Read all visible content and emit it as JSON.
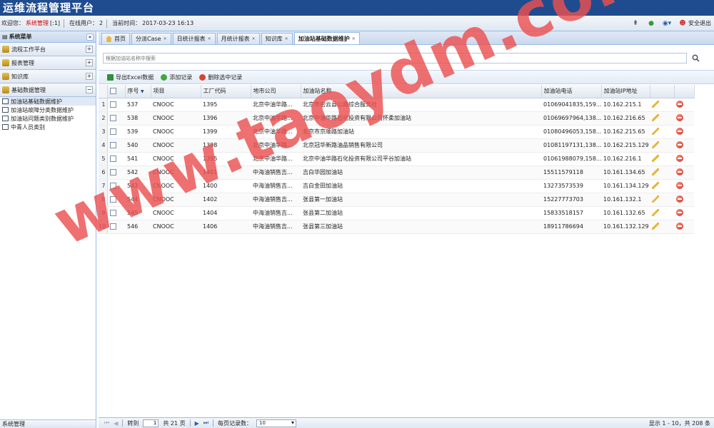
{
  "app": {
    "title": "运维流程管理平台"
  },
  "infobar": {
    "welcome_label": "欢迎您：",
    "user_name": "系统管理",
    "user_suffix": "[:1]",
    "online_label": "在线用户：",
    "online_count": "2",
    "time_label": "当前时间：",
    "time_value": "2017-03-23 16:13",
    "logout_label": "安全退出"
  },
  "sidebar": {
    "title": "系统菜单",
    "groups": [
      {
        "label": "流程工作平台"
      },
      {
        "label": "报表管理"
      },
      {
        "label": "知识库"
      },
      {
        "label": "基础数据管理"
      }
    ],
    "sub_items": [
      {
        "label": "加油站基础数据维护"
      },
      {
        "label": "加油站故障分类数据维护"
      },
      {
        "label": "加油站问题类别数据维护"
      },
      {
        "label": "中青人员类别"
      }
    ],
    "bottom_label": "系统管理"
  },
  "tabs": [
    {
      "label": "首页"
    },
    {
      "label": "分派Case"
    },
    {
      "label": "日统计报表"
    },
    {
      "label": "月统计报表"
    },
    {
      "label": "知识库"
    },
    {
      "label": "加油站基础数据维护"
    }
  ],
  "search": {
    "placeholder": "根据加油站名称中搜索"
  },
  "toolbar": {
    "export_label": "导出Excel数据",
    "add_label": "添加记录",
    "delete_label": "删除选中记录"
  },
  "table": {
    "columns": [
      "序号",
      "项目",
      "工厂代码",
      "地市公司",
      "加油站名称",
      "加油站电话",
      "加油站IP地址"
    ],
    "rows": [
      [
        "537",
        "CNOOC",
        "1395",
        "北京中油华路...",
        "北京市密云县公路综合服务社",
        "01069041835,159...",
        "10.162.215.1"
      ],
      [
        "538",
        "CNOOC",
        "1396",
        "北京中油华路...",
        "北京中油华路石化投资有限公司怀柔加油站",
        "01069697964,138...",
        "10.162.216.65"
      ],
      [
        "539",
        "CNOOC",
        "1399",
        "北京中油华路...",
        "北京市京顺路加油站",
        "01080496053,158...",
        "10.162.215.65"
      ],
      [
        "540",
        "CNOOC",
        "1398",
        "北京中油华路...",
        "北京冠华新路油品销售有限公司",
        "01081197131,138...",
        "10.162.215.129"
      ],
      [
        "541",
        "CNOOC",
        "1395",
        "北京中油华路...",
        "北京中油华路石化投资有限公司平谷加油站",
        "01061988079,158...",
        "10.162.216.1"
      ],
      [
        "542",
        "CNOOC",
        "1401",
        "中海油销售吉...",
        "吉白华园加油站",
        "15511579118",
        "10.161.134.65"
      ],
      [
        "543",
        "CNOOC",
        "1400",
        "中海油销售吉...",
        "吉白金田加油站",
        "13273573539",
        "10.161.134.129"
      ],
      [
        "544",
        "CNOOC",
        "1402",
        "中海油销售吉...",
        "张县第一加油站",
        "15227773703",
        "10.161.132.1"
      ],
      [
        "545",
        "CNOOC",
        "1404",
        "中海油销售吉...",
        "张县第二加油站",
        "15833518157",
        "10.161.132.65"
      ],
      [
        "546",
        "CNOOC",
        "1406",
        "中海油销售吉...",
        "张县第三加油站",
        "18911786694",
        "10.161.132.129"
      ]
    ]
  },
  "pager": {
    "goto_label": "转到",
    "page_value": "1",
    "total_pages": "共 21 页",
    "page_size_label": "每页记录数：",
    "page_size_value": "10",
    "summary": "显示 1 - 10，共 208 条"
  },
  "watermark": {
    "text": "www.taoydm.com"
  },
  "colors": {
    "header_bg": "#1f4c8f",
    "accent_border": "#99bbe8",
    "watermark": "#eb5050"
  }
}
